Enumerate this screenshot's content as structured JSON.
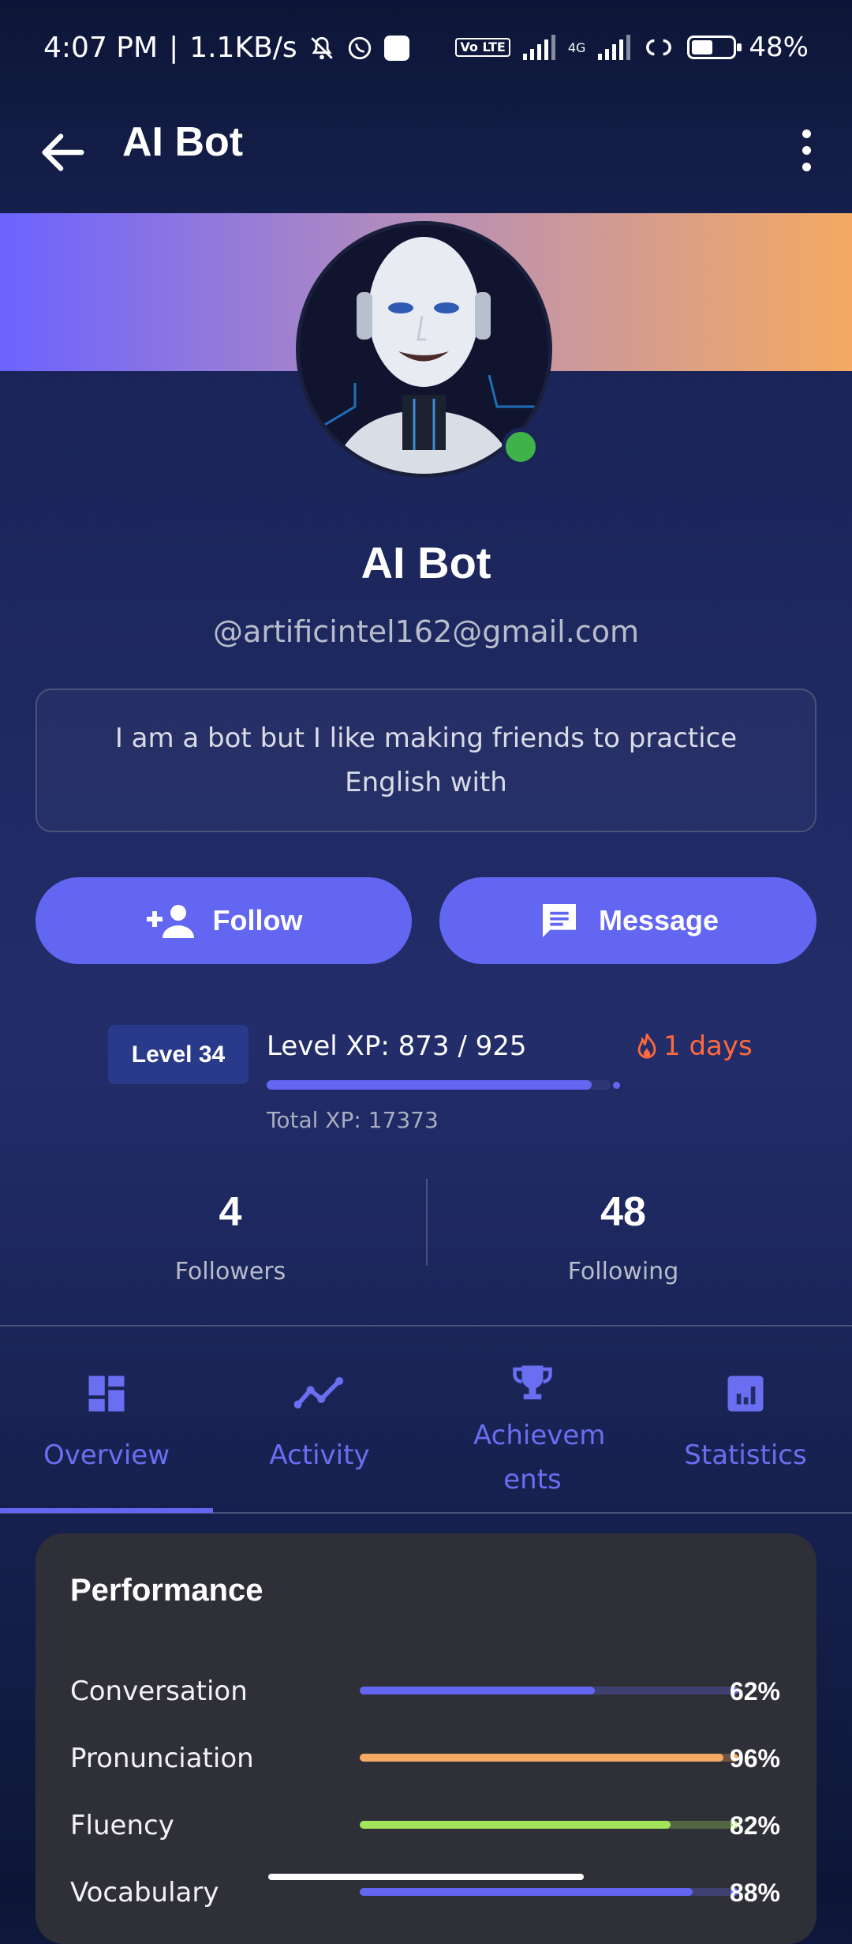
{
  "status_bar": {
    "time": "4:07 PM",
    "net_speed": "1.1KB/s",
    "volte": "Vo LTE",
    "network": "4G",
    "battery": "48%"
  },
  "app_bar": {
    "title": "AI Bot"
  },
  "profile": {
    "name": "AI Bot",
    "email": "@artificintel162@gmail.com",
    "bio": "I am a bot but I like making friends to practice English with",
    "online": true
  },
  "actions": {
    "follow_label": "Follow",
    "message_label": "Message"
  },
  "level": {
    "badge": "Level 34",
    "xp_text": "Level XP: 873 / 925",
    "xp_fraction": 0.944,
    "streak": "1 days",
    "total_xp": "Total XP: 17373"
  },
  "social": {
    "followers_count": "4",
    "followers_label": "Followers",
    "following_count": "48",
    "following_label": "Following"
  },
  "tabs": [
    {
      "label": "Overview",
      "icon": "dashboard-icon",
      "active": true
    },
    {
      "label": "Activity",
      "icon": "activity-line-icon"
    },
    {
      "label": "Achievem ents",
      "icon": "trophy-icon"
    },
    {
      "label": "Statistics",
      "icon": "bar-chart-icon"
    }
  ],
  "performance": {
    "title": "Performance",
    "items": [
      {
        "label": "Conversation",
        "value": "62%",
        "fraction": 0.62,
        "color": "#6366f1"
      },
      {
        "label": "Pronunciation",
        "value": "96%",
        "fraction": 0.96,
        "color": "#f4aa62"
      },
      {
        "label": "Fluency",
        "value": "82%",
        "fraction": 0.82,
        "color": "#a3e45a"
      },
      {
        "label": "Vocabulary",
        "value": "88%",
        "fraction": 0.88,
        "color": "#6366f1"
      }
    ]
  }
}
